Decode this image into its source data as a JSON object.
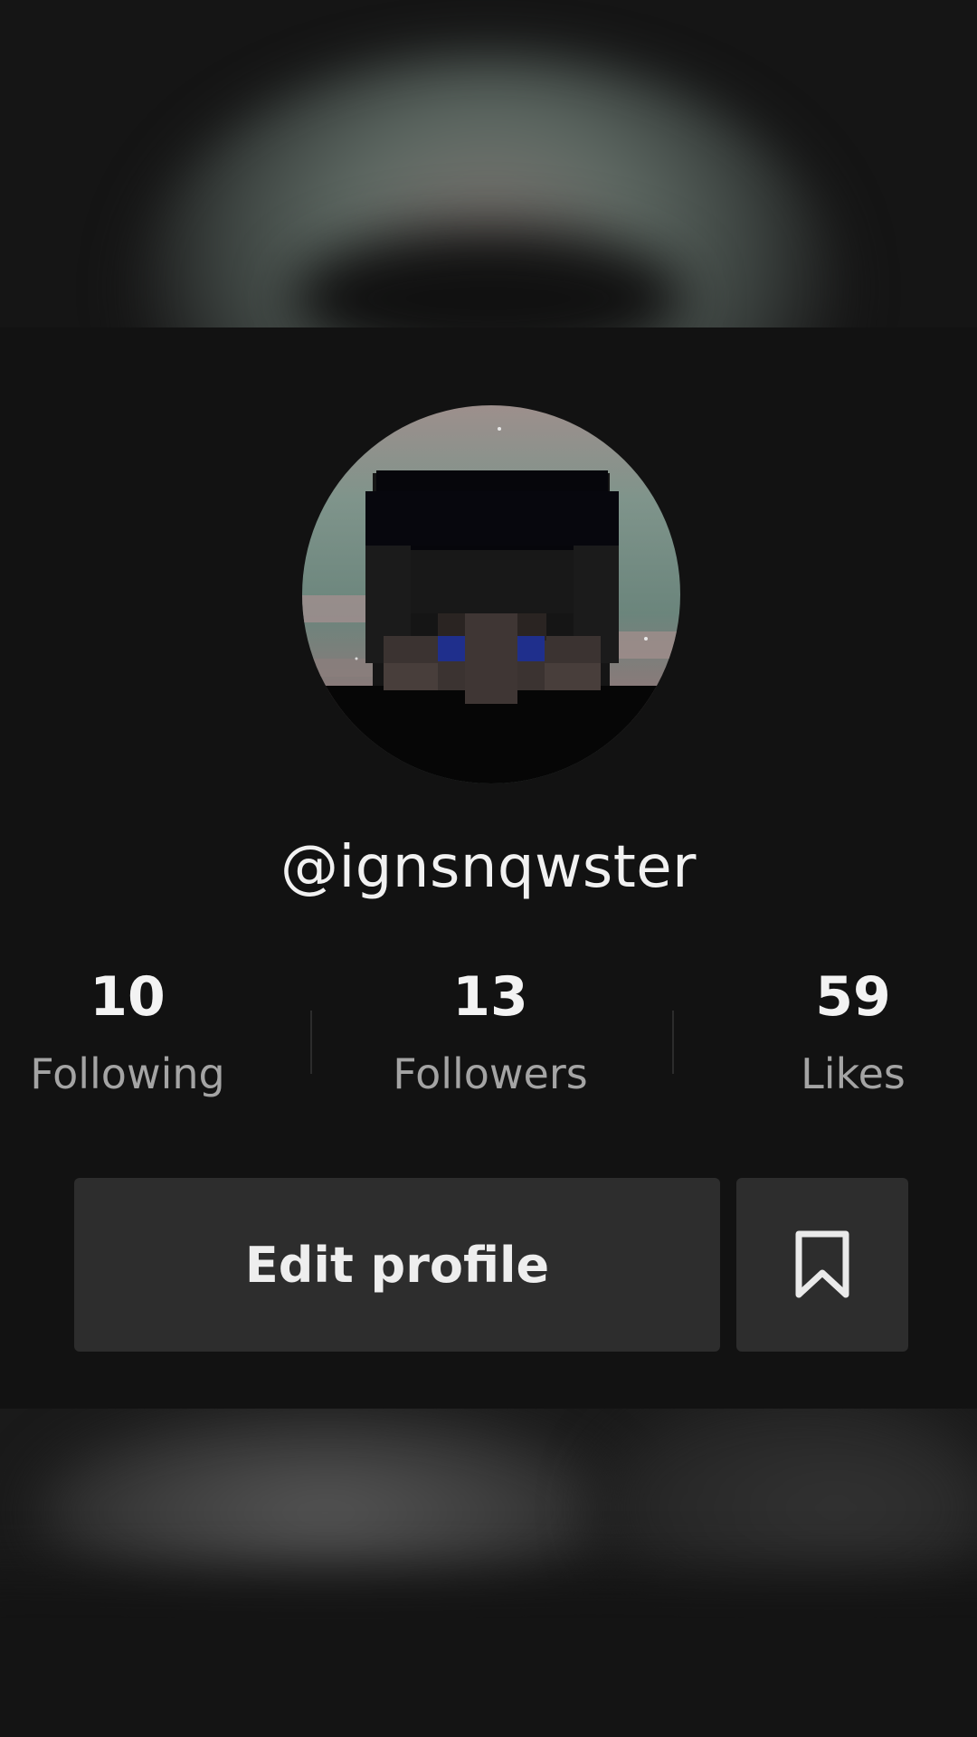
{
  "profile": {
    "username": "@ignsnqwster",
    "avatar_icon": "pixel-character-avatar"
  },
  "stats": {
    "following": {
      "count": "10",
      "label": "Following"
    },
    "followers": {
      "count": "13",
      "label": "Followers"
    },
    "likes": {
      "count": "59",
      "label": "Likes"
    }
  },
  "actions": {
    "edit_profile_label": "Edit profile",
    "bookmark_icon": "bookmark-icon"
  },
  "colors": {
    "background": "#121212",
    "button_bg": "#2d2d2d",
    "text_primary": "#f1f1f1",
    "text_secondary": "#a4a4a4"
  }
}
